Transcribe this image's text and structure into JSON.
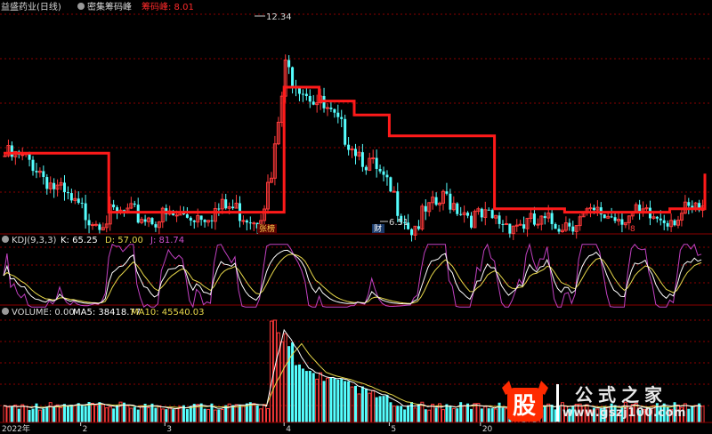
{
  "header": {
    "stock_name": "益盛药业(日线)",
    "indicator_name": "密集筹码峰",
    "indicator_value_label": "筹码峰: 8.01"
  },
  "main_panel": {
    "high_label": "12.34",
    "low_label": "6.51",
    "event_tag_1": "张榜",
    "event_tag_2": "财",
    "event_tag_3": "8"
  },
  "kdj_panel": {
    "params_label": "KDJ(9,3,3)",
    "k_label": "K: 65.25",
    "d_label": "D: 57.00",
    "j_label": "J: 81.74"
  },
  "volume_panel": {
    "volume_label": "VOLUME: 0.00",
    "ma5_label": "MA5: 38418.77",
    "ma10_label": "MA10: 45540.03"
  },
  "x_axis": {
    "year_label": "2022年",
    "months": [
      "2",
      "3",
      "4",
      "5",
      "20"
    ]
  },
  "watermark": {
    "logo_char": "股",
    "title": "公式之家",
    "url": "www.gszj100.com"
  },
  "colors": {
    "up": "#ff3a3a",
    "down": "#55ffff",
    "chip_peak_line": "#ff1a1a",
    "k_line": "#ffffff",
    "d_line": "#e8d84a",
    "j_line": "#c040c0",
    "ma5": "#ffffff",
    "ma10": "#e8d84a",
    "grid": "#8b0000"
  },
  "chart_data": [
    {
      "type": "line",
      "title": "密集筹码峰",
      "description_label": "筹码峰: 8.01",
      "x": [
        0,
        10,
        20,
        30,
        40,
        50,
        60,
        70,
        80,
        90,
        100,
        110,
        120,
        130,
        140,
        150,
        160,
        170,
        180,
        190,
        200
      ],
      "series": [
        {
          "name": "筹码峰",
          "values": [
            8.6,
            8.6,
            8.6,
            6.9,
            6.9,
            6.9,
            6.9,
            6.9,
            10.5,
            10.1,
            9.7,
            9.1,
            9.1,
            9.1,
            7.0,
            7.0,
            6.9,
            6.9,
            6.9,
            7.0,
            8.01
          ]
        }
      ],
      "ylim": [
        6.3,
        12.6
      ],
      "annotations": [
        {
          "label": "12.34",
          "value": 12.34
        },
        {
          "label": "6.51",
          "value": 6.51
        }
      ]
    },
    {
      "type": "line",
      "title": "KDJ(9,3,3)",
      "series": [
        {
          "name": "K",
          "last": 65.25
        },
        {
          "name": "D",
          "last": 57.0
        },
        {
          "name": "J",
          "last": 81.74
        }
      ]
    },
    {
      "type": "bar",
      "title": "VOLUME",
      "series": [
        {
          "name": "VOLUME",
          "last": 0.0
        },
        {
          "name": "MA5",
          "last": 38418.77
        },
        {
          "name": "MA10",
          "last": 45540.03
        }
      ]
    }
  ]
}
